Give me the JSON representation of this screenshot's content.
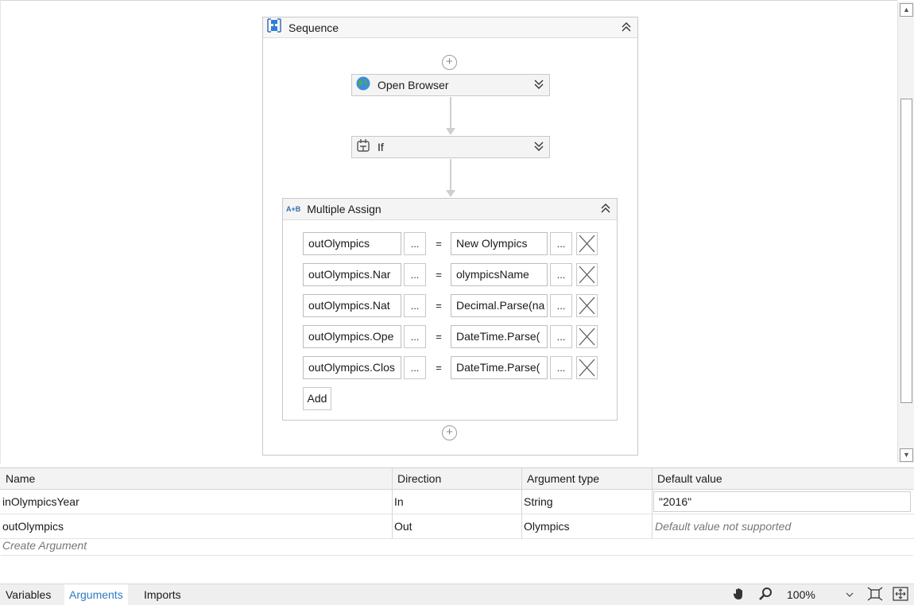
{
  "designer": {
    "sequence": {
      "title": "Sequence",
      "icon": "sequence-icon"
    },
    "activities": [
      {
        "label": "Open Browser",
        "icon": "globe-icon"
      },
      {
        "label": "If",
        "icon": "if-icon"
      }
    ],
    "multiple_assign": {
      "title": "Multiple Assign",
      "icon": "assign-icon",
      "icon_text": "A+B",
      "rows": [
        {
          "to": "outOlympics",
          "value": "New Olympics"
        },
        {
          "to": "outOlympics.Nar",
          "value": "olympicsName"
        },
        {
          "to": "outOlympics.Nat",
          "value": "Decimal.Parse(na"
        },
        {
          "to": "outOlympics.Ope",
          "value": "DateTime.Parse("
        },
        {
          "to": "outOlympics.Clos",
          "value": "DateTime.Parse("
        }
      ],
      "dots_label": "...",
      "equals": "=",
      "add_label": "Add"
    }
  },
  "arguments": {
    "columns": [
      "Name",
      "Direction",
      "Argument type",
      "Default value"
    ],
    "rows": [
      {
        "name": "inOlympicsYear",
        "direction": "In",
        "type": "String",
        "default": "\"2016\""
      },
      {
        "name": "outOlympics",
        "direction": "Out",
        "type": "Olympics",
        "default": "Default value not supported"
      }
    ],
    "create_label": "Create Argument"
  },
  "bottom_bar": {
    "tabs": [
      "Variables",
      "Arguments",
      "Imports"
    ],
    "active_tab": "Arguments",
    "zoom": "100%"
  },
  "colors": {
    "accent": "#2c7bbf",
    "border": "#c8c8c8"
  }
}
